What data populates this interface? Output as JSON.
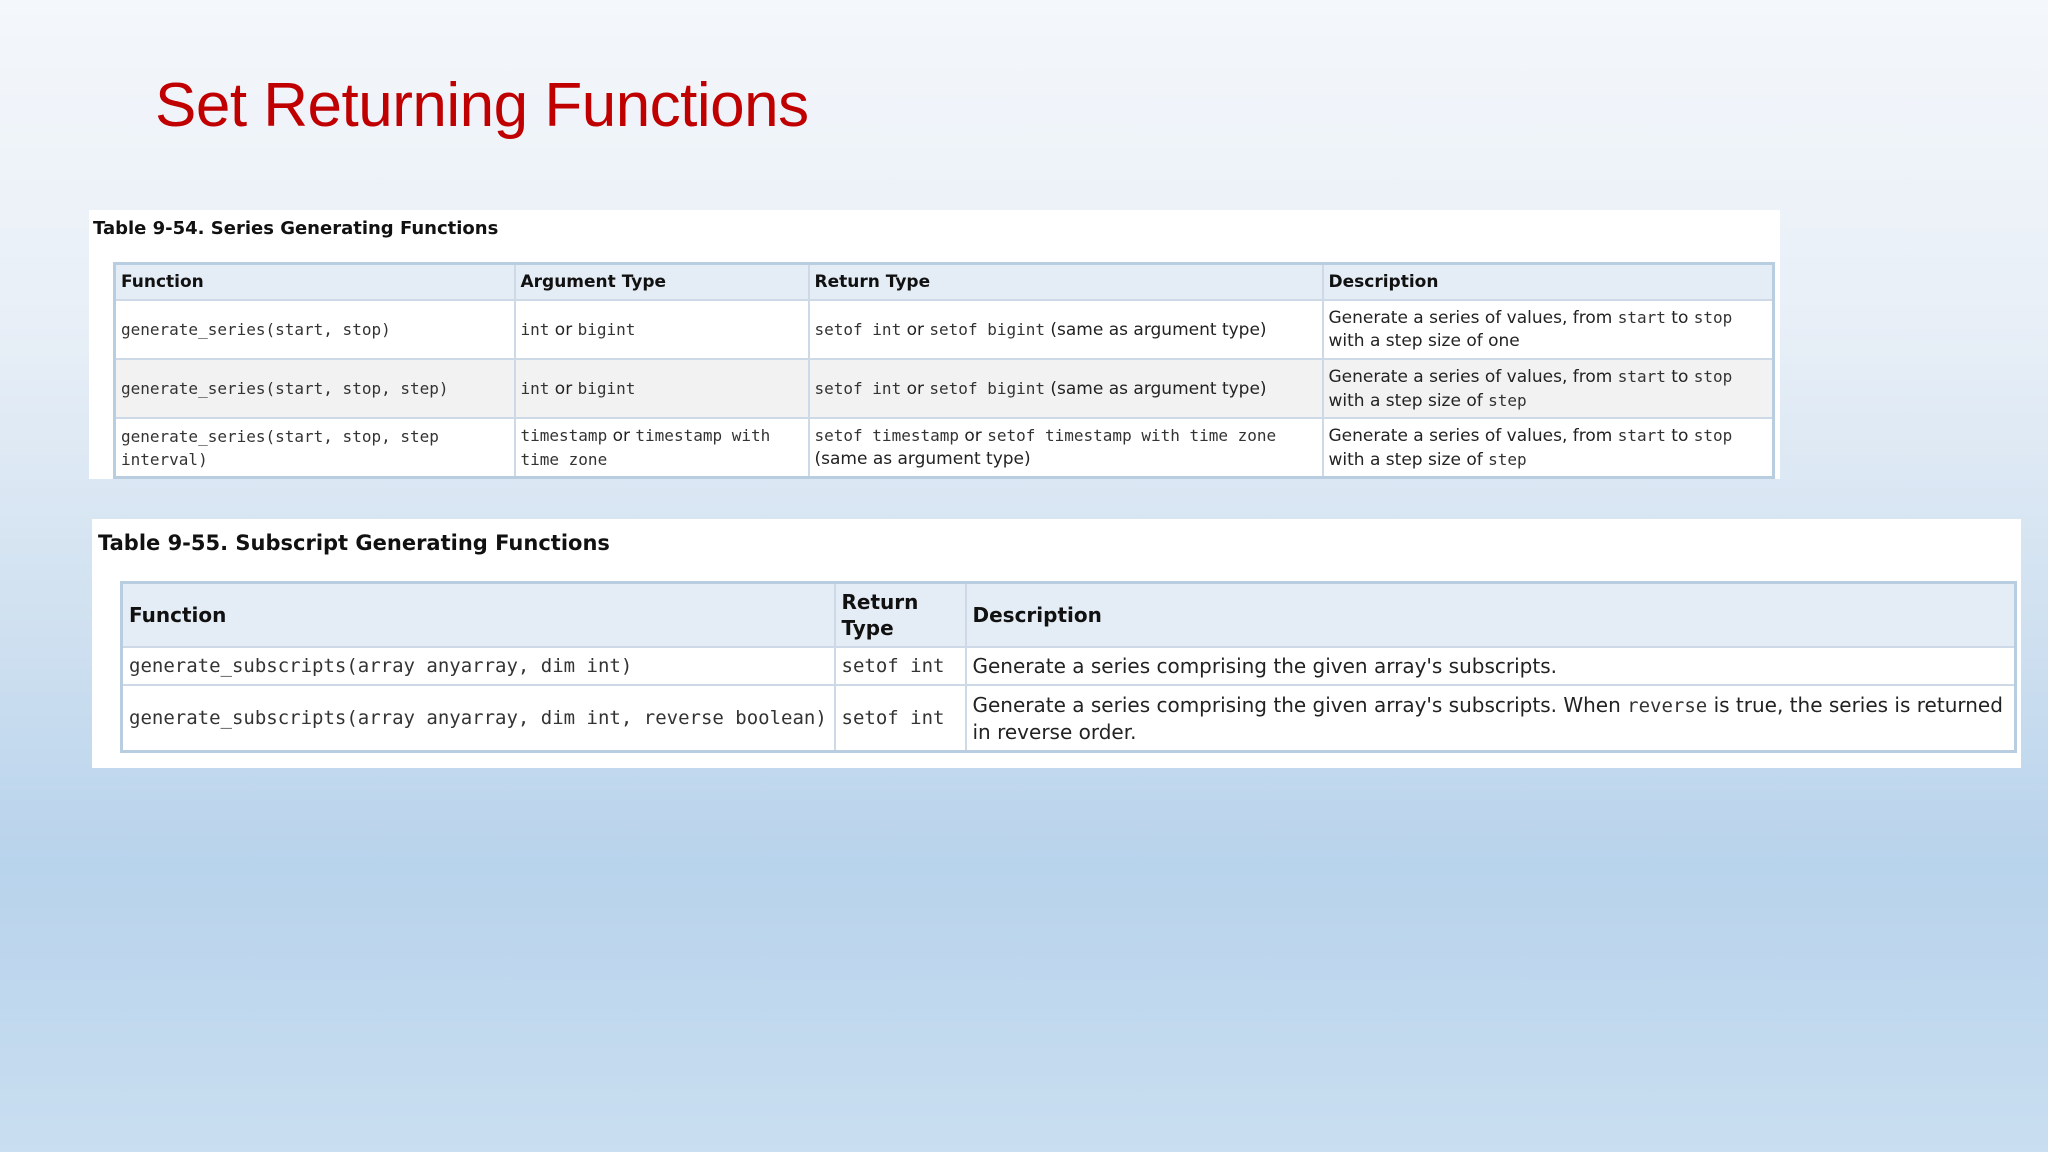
{
  "slide": {
    "title": "Set Returning Functions"
  },
  "table1": {
    "caption": "Table 9-54. Series Generating Functions",
    "headers": [
      "Function",
      "Argument Type",
      "Return Type",
      "Description"
    ],
    "rows": [
      {
        "function": "generate_series(start, stop)",
        "arg": {
          "t1": "int",
          "or": " or ",
          "t2": "bigint"
        },
        "ret": {
          "a": "setof int",
          "or": " or ",
          "b": "setof bigint",
          "note": " (same as argument type)"
        },
        "desc": {
          "p1": "Generate a series of values, from ",
          "c1": "start",
          "p2": " to ",
          "c2": "stop",
          "p3": " with a step size of one"
        }
      },
      {
        "function": "generate_series(start, stop, step)",
        "arg": {
          "t1": "int",
          "or": " or ",
          "t2": "bigint"
        },
        "ret": {
          "a": "setof int",
          "or": " or ",
          "b": "setof bigint",
          "note": " (same as argument type)"
        },
        "desc": {
          "p1": "Generate a series of values, from ",
          "c1": "start",
          "p2": " to ",
          "c2": "stop",
          "p3": " with a step size of ",
          "c3": "step"
        }
      },
      {
        "function": "generate_series(start, stop, step interval)",
        "arg": {
          "t1": "timestamp",
          "or": " or ",
          "t2": "timestamp with time zone"
        },
        "ret": {
          "a": "setof timestamp",
          "or": " or ",
          "b": "setof timestamp with time zone",
          "note": " (same as argument type)"
        },
        "desc": {
          "p1": "Generate a series of values, from ",
          "c1": "start",
          "p2": " to ",
          "c2": "stop",
          "p3": " with a step size of ",
          "c3": "step"
        }
      }
    ]
  },
  "table2": {
    "caption": "Table 9-55. Subscript Generating Functions",
    "headers": [
      "Function",
      "Return Type",
      "Description"
    ],
    "rows": [
      {
        "function": "generate_subscripts(array anyarray, dim int)",
        "ret": "setof int",
        "desc": {
          "p1": "Generate a series comprising the given array's subscripts."
        }
      },
      {
        "function": "generate_subscripts(array anyarray, dim int, reverse boolean)",
        "ret": "setof int",
        "desc": {
          "p1": "Generate a series comprising the given array's subscripts. When ",
          "c1": "reverse",
          "p2": " is true, the series is returned in reverse order."
        }
      }
    ]
  }
}
